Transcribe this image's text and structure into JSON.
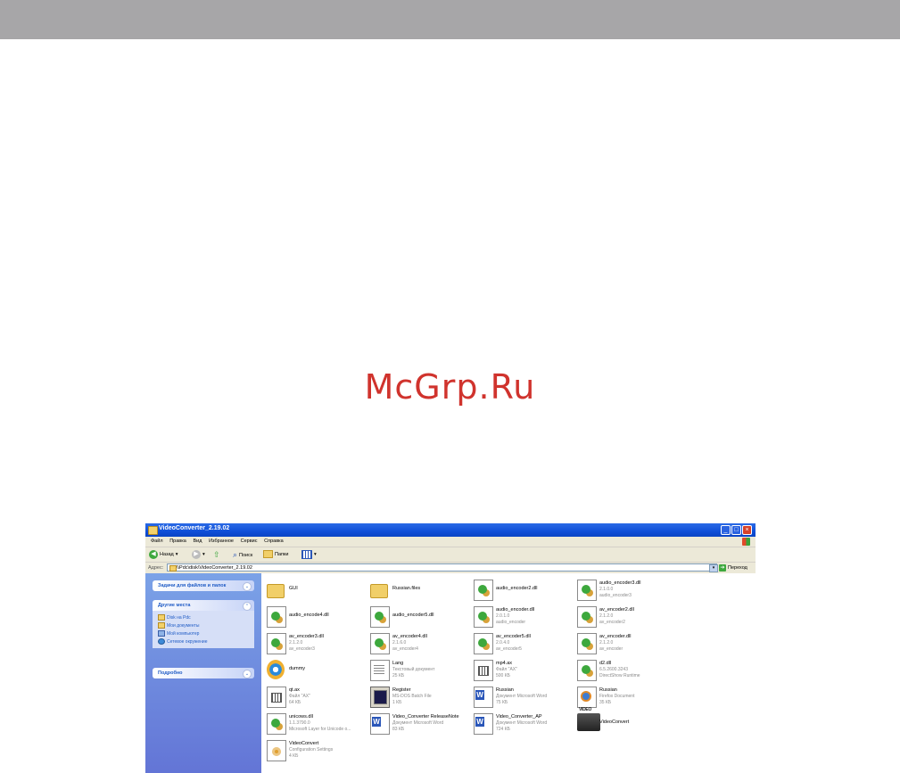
{
  "watermark": "McGrp.Ru",
  "window": {
    "title": "VideoConverter_2.19.02",
    "menu": [
      "Файл",
      "Правка",
      "Вид",
      "Избранное",
      "Сервис",
      "Справка"
    ],
    "toolbar": {
      "back": "Назад",
      "search": "Поиск",
      "folders": "Папки"
    },
    "address": {
      "label": "Адрес:",
      "path": "\\\\Pdc\\disk\\VideoConverter_2.19.02",
      "go": "Переход"
    },
    "sidebar": {
      "tasks_title": "Задачи для файлов и папок",
      "places_title": "Другие места",
      "places": [
        "Disk на Pdc",
        "Мои документы",
        "Мой компьютер",
        "Сетевое окружение"
      ],
      "details_title": "Подробно"
    },
    "files": [
      {
        "name": "GUI",
        "icon": "folder-icon",
        "lines": []
      },
      {
        "name": "Russian.files",
        "icon": "folder-icon",
        "lines": []
      },
      {
        "name": "audio_encoder2.dll",
        "icon": "dll-icon",
        "lines": []
      },
      {
        "name": "audio_encoder3.dll",
        "icon": "dll-icon",
        "lines": [
          "2.1.0.0",
          "audio_encoder3"
        ]
      },
      {
        "name": "audio_encode4.dll",
        "icon": "dll-icon",
        "lines": []
      },
      {
        "name": "audio_encoder5.dll",
        "icon": "dll-icon",
        "lines": []
      },
      {
        "name": "audio_encoder.dll",
        "icon": "dll-icon",
        "lines": [
          "2.0.1.0",
          "audio_encoder"
        ]
      },
      {
        "name": "av_encoder2.dll",
        "icon": "dll-icon",
        "lines": [
          "2.1.2.0",
          "av_encoder2"
        ]
      },
      {
        "name": "av_encoder3.dll",
        "icon": "dll-icon",
        "lines": [
          "2.1.2.0",
          "av_encoder3"
        ]
      },
      {
        "name": "av_encoder4.dll",
        "icon": "dll-icon",
        "lines": [
          "2.1.6.0",
          "av_encoder4"
        ]
      },
      {
        "name": "av_encoder5.dll",
        "icon": "dll-icon",
        "lines": [
          "2.0.4.0",
          "av_encoder5"
        ]
      },
      {
        "name": "av_encoder.dll",
        "icon": "dll-icon",
        "lines": [
          "2.1.2.0",
          "av_encoder"
        ]
      },
      {
        "name": "dummy",
        "icon": "media-player-icon",
        "lines": []
      },
      {
        "name": "Lang",
        "icon": "text-document-icon",
        "lines": [
          "Текстовый документ",
          "25 КБ"
        ]
      },
      {
        "name": "mp4.ax",
        "icon": "ax-file-icon",
        "lines": [
          "Файл \"AX\"",
          "500 КБ"
        ]
      },
      {
        "name": "d2.dll",
        "icon": "dll-icon",
        "lines": [
          "6.5.2600.3243",
          "DirectShow Runtime"
        ]
      },
      {
        "name": "qt.ax",
        "icon": "ax-file-icon",
        "lines": [
          "Файл \"AX\"",
          "64 КБ"
        ]
      },
      {
        "name": "Register",
        "icon": "batch-file-icon",
        "lines": [
          "MS-DOS Batch File",
          "1 КБ"
        ]
      },
      {
        "name": "Russian",
        "icon": "word-document-icon",
        "lines": [
          "Документ Microsoft Word",
          "75 КБ"
        ]
      },
      {
        "name": "Russian",
        "icon": "firefox-document-icon",
        "lines": [
          "Firefox Document",
          "35 КБ"
        ]
      },
      {
        "name": "unicows.dll",
        "icon": "dll-icon",
        "lines": [
          "1.1.3790.0",
          "Microsoft Layer for Unicode o..."
        ]
      },
      {
        "name": "Video_Converter ReleaseNote",
        "icon": "word-document-icon",
        "lines": [
          "Документ Microsoft Word",
          "83 КБ"
        ]
      },
      {
        "name": "Video_Converter_AP",
        "icon": "word-document-icon",
        "lines": [
          "Документ Microsoft Word",
          "724 КБ"
        ]
      },
      {
        "name": "VideoConvert",
        "icon": "video-camera-icon",
        "lines": []
      },
      {
        "name": "VideoConvert",
        "icon": "config-settings-icon",
        "lines": [
          "Configuration Settings",
          "4 КБ"
        ]
      }
    ]
  }
}
